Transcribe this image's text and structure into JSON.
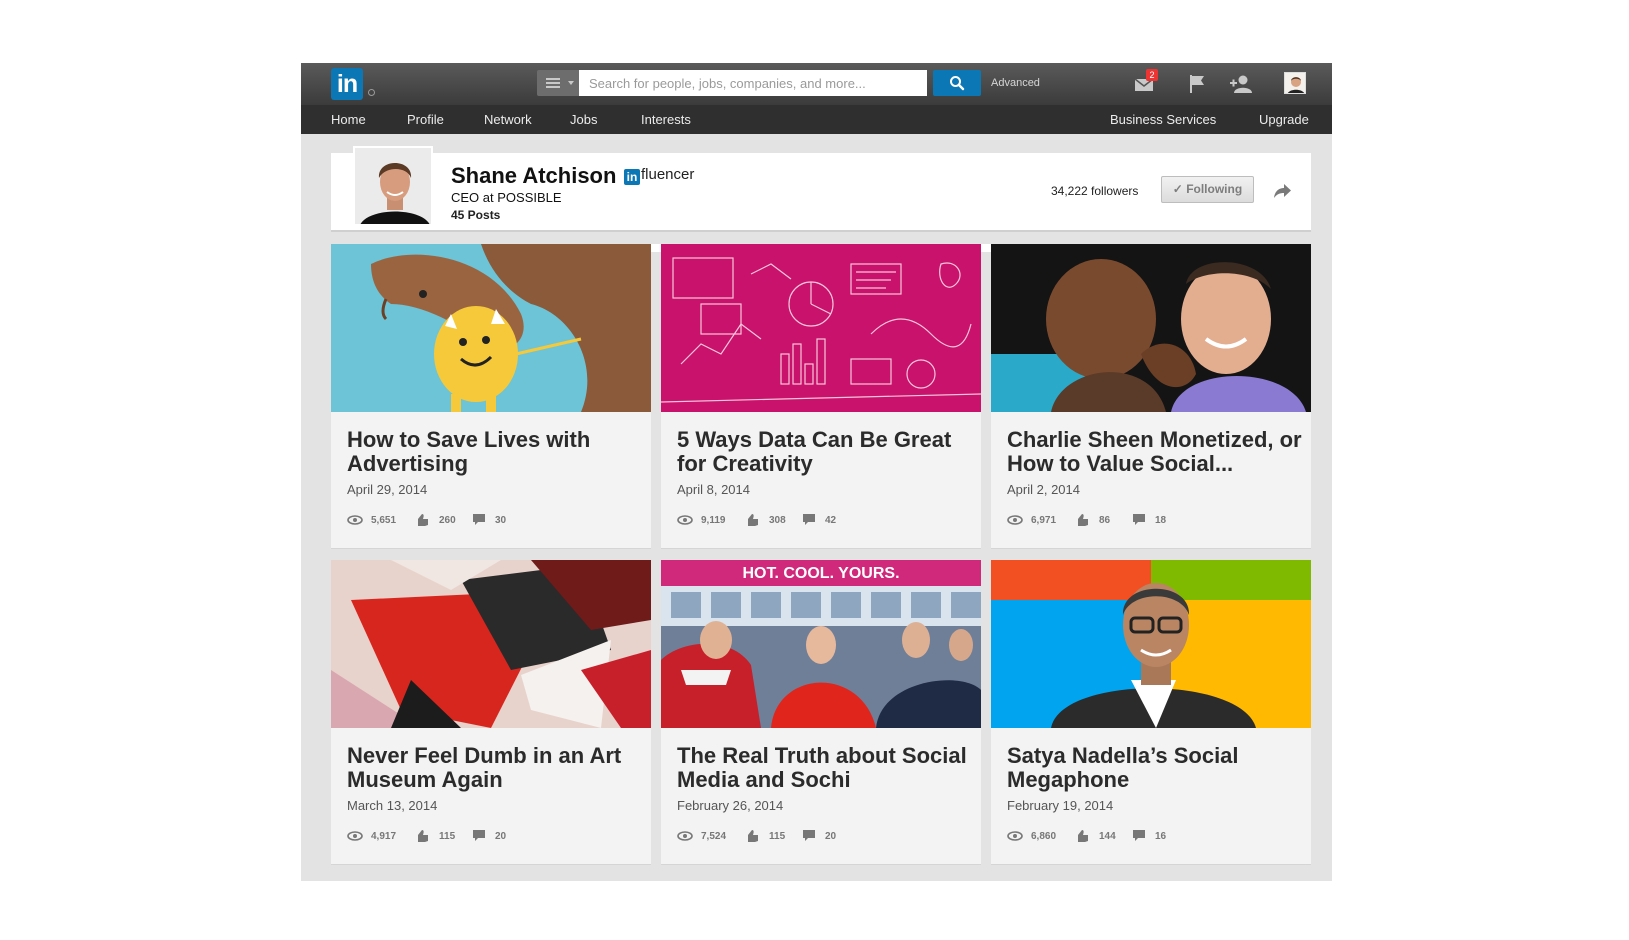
{
  "topbar": {
    "logo_text": "in",
    "search_placeholder": "Search for people, jobs, companies, and more...",
    "advanced_label": "Advanced",
    "inbox_count": "2"
  },
  "nav": {
    "left": [
      "Home",
      "Profile",
      "Network",
      "Jobs",
      "Interests"
    ],
    "right": [
      "Business Services",
      "Upgrade"
    ]
  },
  "profile": {
    "name": "Shane Atchison",
    "badge_mark": "in",
    "badge_text": "fluencer",
    "headline": "CEO at POSSIBLE",
    "posts": "45 Posts",
    "followers": "34,222 followers",
    "follow_label": "Following"
  },
  "posts": [
    {
      "title": "How to Save Lives with Advertising",
      "date": "April 29, 2014",
      "views": "5,651",
      "likes": "260",
      "comments": "30"
    },
    {
      "title": "5 Ways Data Can Be Great for Creativity",
      "date": "April 8, 2014",
      "views": "9,119",
      "likes": "308",
      "comments": "42"
    },
    {
      "title": "Charlie Sheen Monetized, or How to Value Social...",
      "date": "April 2, 2014",
      "views": "6,971",
      "likes": "86",
      "comments": "18"
    },
    {
      "title": "Never Feel Dumb in an Art Museum Again",
      "date": "March 13, 2014",
      "views": "4,917",
      "likes": "115",
      "comments": "20"
    },
    {
      "title": "The Real Truth about Social Media and Sochi",
      "date": "February 26, 2014",
      "views": "7,524",
      "likes": "115",
      "comments": "20"
    },
    {
      "title": "Satya Nadella’s Social Megaphone",
      "date": "February 19, 2014",
      "views": "6,860",
      "likes": "144",
      "comments": "16"
    }
  ],
  "thumbnail_text": {
    "sochi_banner": "HOT. COOL. YOURS."
  },
  "colors": {
    "brand_blue": "#0b77b5",
    "topbar": "#3b3b3b",
    "navbar": "#2f2f2f",
    "data_magenta": "#c8126b",
    "cartoon_sky": "#6cc4d6"
  }
}
